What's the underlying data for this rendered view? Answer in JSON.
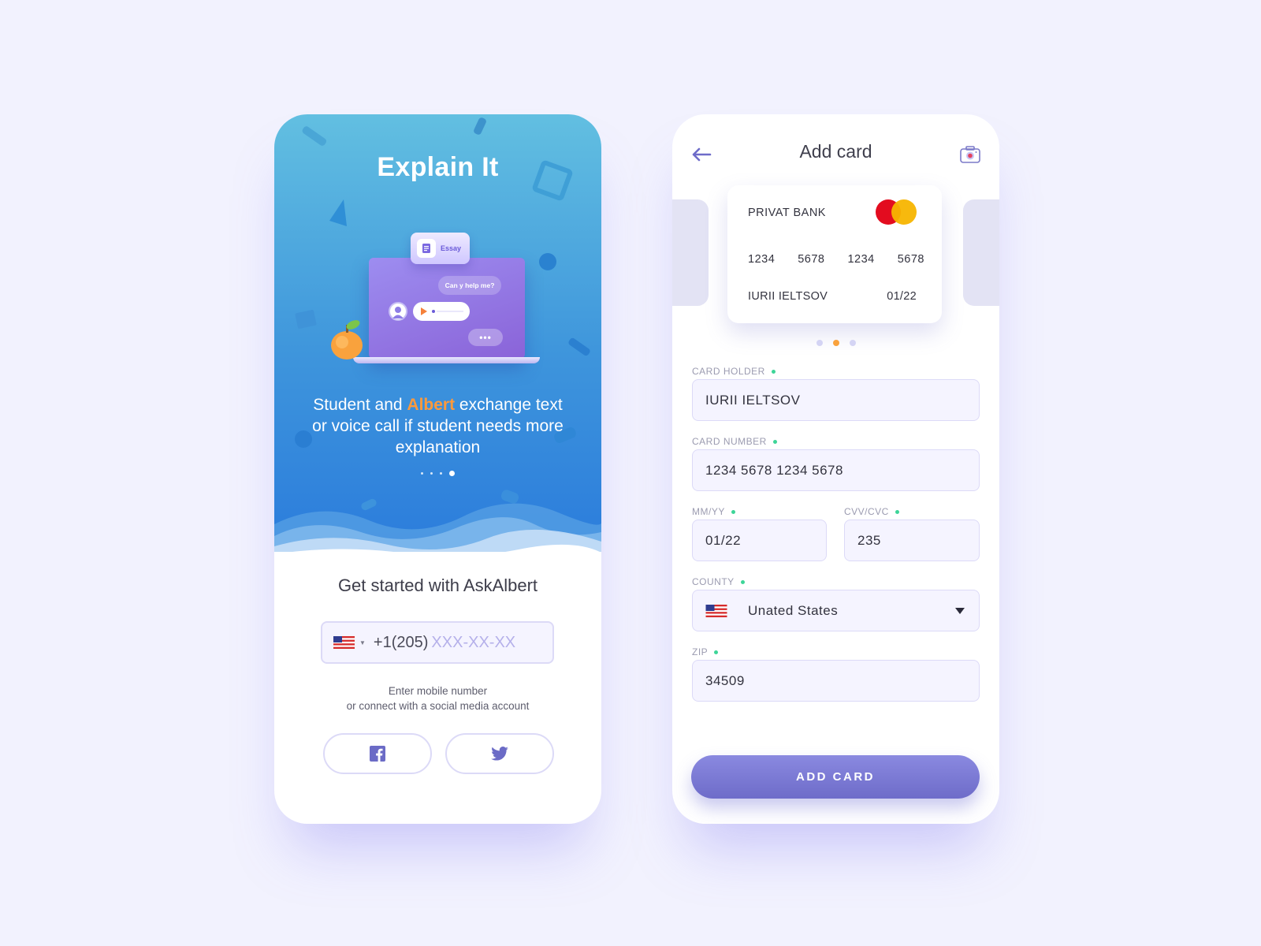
{
  "onboarding": {
    "app_title": "Explain It",
    "illustration": {
      "essay_tag": "Essay",
      "chat_bubble": "Can y help me?",
      "typing": "•••"
    },
    "description": {
      "before": "Student and ",
      "highlight": "Albert",
      "after": " exchange text or voice call if student needs more explanation"
    },
    "carousel": {
      "total": 4,
      "active": 4
    },
    "get_started": "Get started with AskAlbert",
    "phone_input": {
      "country_flag": "us-flag-icon",
      "prefix": "+1(205)",
      "placeholder": "XXX-XX-XX"
    },
    "helper_line1": "Enter mobile number",
    "helper_line2": "or connect with a social media account",
    "social": [
      "facebook-icon",
      "twitter-icon"
    ],
    "colors": {
      "accent": "#ff9a3c",
      "hero_top": "#62bfe1",
      "hero_bottom": "#2b7cdc"
    }
  },
  "add_card": {
    "title": "Add card",
    "back_icon": "arrow-left-icon",
    "camera_icon": "camera-icon",
    "card": {
      "bank": "PRIVAT BANK",
      "brand_icon": "mastercard-icon",
      "number_groups": [
        "1234",
        "5678",
        "1234",
        "5678"
      ],
      "holder": "IURII IELTSOV",
      "expiry": "01/22"
    },
    "carousel": {
      "total": 3,
      "active": 2
    },
    "fields": {
      "holder_label": "CARD HOLDER",
      "holder_value": "IURII IELTSOV",
      "number_label": "CARD NUMBER",
      "number_value": "1234 5678 1234 5678",
      "expiry_label": "MM/YY",
      "expiry_value": "01/22",
      "cvv_label": "CVV/CVC",
      "cvv_value": "235",
      "country_label": "COUNTY",
      "country_value": "Unated States",
      "zip_label": "ZIP",
      "zip_value": "34509"
    },
    "submit_label": "ADD CARD",
    "colors": {
      "primary": "#7775d3",
      "valid_dot": "#3dd598",
      "active_dot": "#f9a23d"
    }
  }
}
